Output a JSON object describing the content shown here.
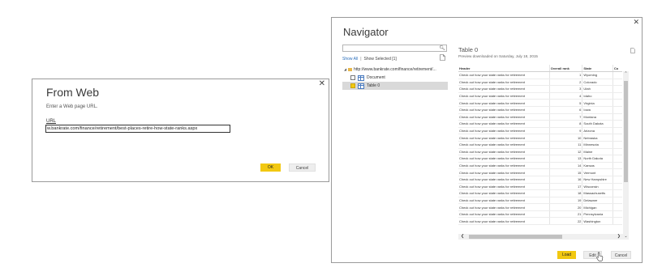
{
  "from_web": {
    "close_glyph": "✕",
    "title": "From Web",
    "prompt": "Enter a Web page URL.",
    "url_label": "URL",
    "url_value": "w.bankrate.com/finance/retirement/best-places-retire-how-state-ranks.aspx",
    "ok_label": "OK",
    "cancel_label": "Cancel"
  },
  "navigator": {
    "close_glyph": "✕",
    "title": "Navigator",
    "search_icon": "search-icon",
    "filter": {
      "show_all": "Show All",
      "separator": "|",
      "show_selected": "Show Selected [1]"
    },
    "tree": {
      "root_label": "http://www.bankrate.com/finance/retirement/...",
      "items": [
        {
          "label": "Document",
          "checked": false
        },
        {
          "label": "Table 0",
          "checked": true
        }
      ]
    },
    "preview": {
      "title": "Table 0",
      "subtitle": "Preview downloaded on Saturday, July 18, 2015",
      "columns": [
        "Header",
        "Overall rank",
        "State",
        "Co"
      ],
      "rows": [
        [
          "Check out how your state ranks for retirement",
          "1",
          "Wyoming"
        ],
        [
          "Check out how your state ranks for retirement",
          "2",
          "Colorado"
        ],
        [
          "Check out how your state ranks for retirement",
          "3",
          "Utah"
        ],
        [
          "Check out how your state ranks for retirement",
          "4",
          "Idaho"
        ],
        [
          "Check out how your state ranks for retirement",
          "5",
          "Virginia"
        ],
        [
          "Check out how your state ranks for retirement",
          "6",
          "Iowa"
        ],
        [
          "Check out how your state ranks for retirement",
          "7",
          "Montana"
        ],
        [
          "Check out how your state ranks for retirement",
          "8",
          "South Dakota"
        ],
        [
          "Check out how your state ranks for retirement",
          "9",
          "Arizona"
        ],
        [
          "Check out how your state ranks for retirement",
          "10",
          "Nebraska"
        ],
        [
          "Check out how your state ranks for retirement",
          "11",
          "Minnesota"
        ],
        [
          "Check out how your state ranks for retirement",
          "12",
          "Maine"
        ],
        [
          "Check out how your state ranks for retirement",
          "13",
          "North Dakota"
        ],
        [
          "Check out how your state ranks for retirement",
          "14",
          "Kansas"
        ],
        [
          "Check out how your state ranks for retirement",
          "15",
          "Vermont"
        ],
        [
          "Check out how your state ranks for retirement",
          "16",
          "New Hampshire"
        ],
        [
          "Check out how your state ranks for retirement",
          "17",
          "Wisconsin"
        ],
        [
          "Check out how your state ranks for retirement",
          "18",
          "Massachusetts"
        ],
        [
          "Check out how your state ranks for retirement",
          "19",
          "Delaware"
        ],
        [
          "Check out how your state ranks for retirement",
          "20",
          "Michigan"
        ],
        [
          "Check out how your state ranks for retirement",
          "21",
          "Pennsylvania"
        ],
        [
          "Check out how your state ranks for retirement",
          "22",
          "Washington"
        ]
      ]
    },
    "buttons": {
      "load": "Load",
      "edit": "Edit",
      "cancel": "Cancel"
    }
  },
  "colors": {
    "accent": "#f2c811",
    "link": "#2a6ebb",
    "button_gray": "#eeeeee"
  }
}
